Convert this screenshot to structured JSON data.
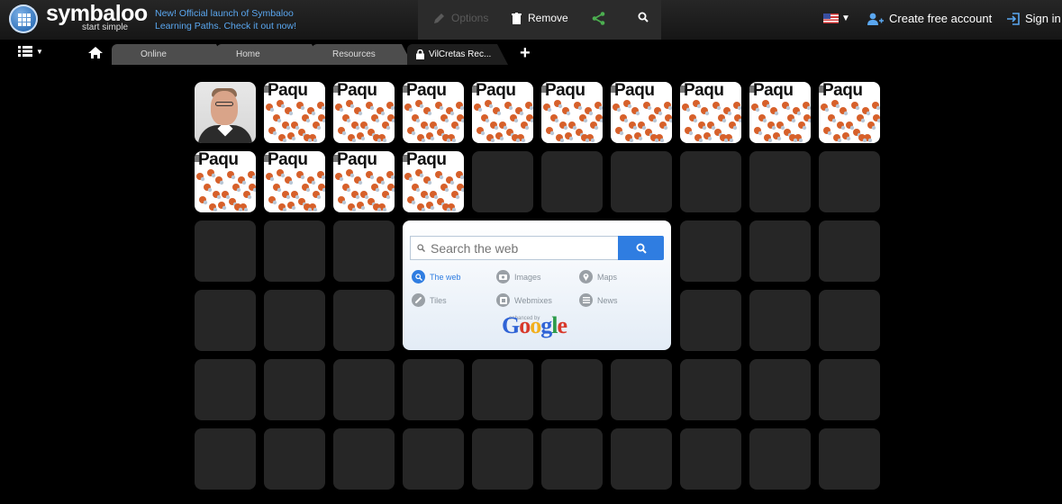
{
  "brand": {
    "name": "symbaloo",
    "tagline": "start simple"
  },
  "announcement": "New! Official launch of Symbaloo Learning Paths. Check it out now!",
  "toolbar": {
    "options_label": "Options",
    "remove_label": "Remove"
  },
  "account": {
    "create_label": "Create free account",
    "signin_label": "Sign in"
  },
  "tabs": [
    {
      "label": "Online"
    },
    {
      "label": "Home"
    },
    {
      "label": "Resources"
    },
    {
      "label": "VilCretas Rec..."
    }
  ],
  "tiles": {
    "paqu_text": "Paqu",
    "paqu_count": 13
  },
  "search": {
    "placeholder": "Search the web",
    "options": [
      {
        "label": "The web",
        "icon": "search-icon"
      },
      {
        "label": "Images",
        "icon": "camera-icon"
      },
      {
        "label": "Maps",
        "icon": "map-pin-icon"
      },
      {
        "label": "Tiles",
        "icon": "link-icon"
      },
      {
        "label": "Webmixes",
        "icon": "grid-icon"
      },
      {
        "label": "News",
        "icon": "news-icon"
      }
    ],
    "powered_label": "enhanced by",
    "powered_brand": "Google"
  },
  "colors": {
    "accent": "#2f7de1",
    "link": "#5aa7f0",
    "share": "#4caf50"
  }
}
